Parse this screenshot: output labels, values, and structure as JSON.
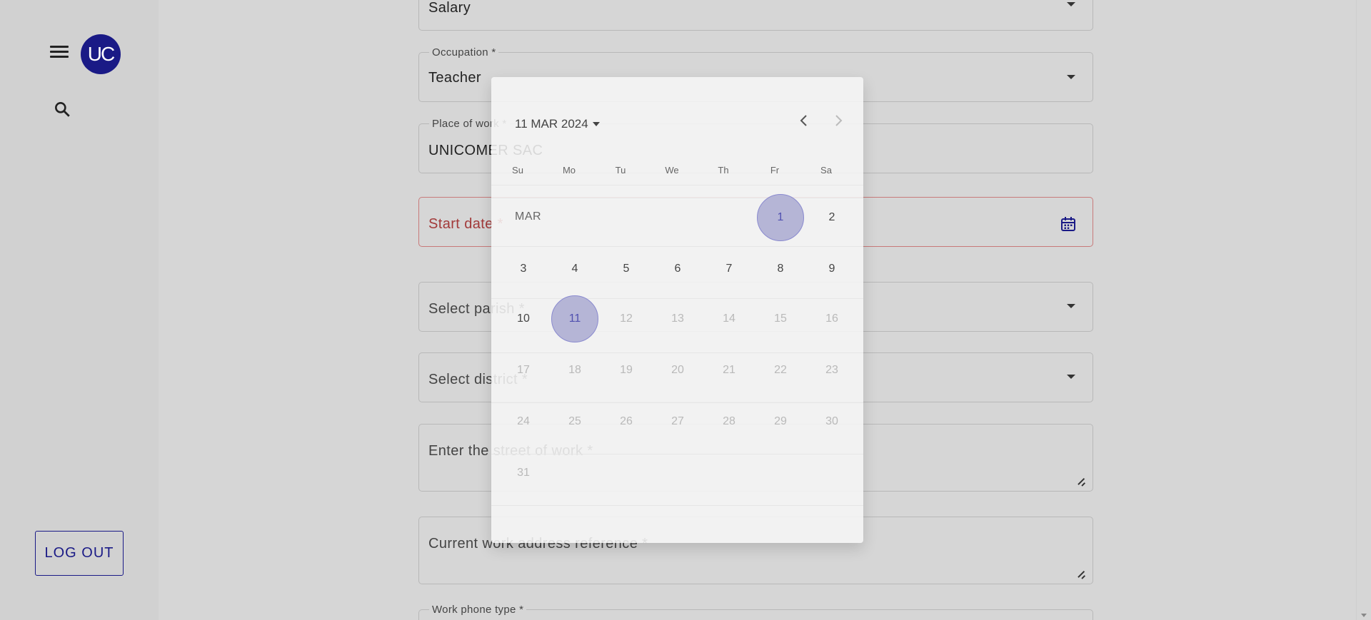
{
  "sidebar": {
    "avatar_text": "UC",
    "logout_label": "LOG OUT",
    "icons": [
      "menu-icon",
      "search-icon"
    ]
  },
  "form": {
    "income_value": "Salary",
    "occupation": {
      "label": "Occupation *",
      "value": "Teacher"
    },
    "place_of_work": {
      "label": "Place of work *",
      "value": "UNICOMER SAC"
    },
    "start_date": {
      "placeholder": "Start date *"
    },
    "parish": {
      "placeholder": "Select parish *"
    },
    "district": {
      "placeholder": "Select district *"
    },
    "street": {
      "placeholder": "Enter the street of work *"
    },
    "reference": {
      "placeholder": "Current work address reference *"
    },
    "phone_type": {
      "label": "Work phone type *"
    }
  },
  "datepicker": {
    "header": "11 MAR 2024",
    "month_label": "MAR",
    "weekdays": [
      "Su",
      "Mo",
      "Tu",
      "We",
      "Th",
      "Fr",
      "Sa"
    ],
    "days": {
      "d1": "1",
      "d2": "2",
      "d3": "3",
      "d4": "4",
      "d5": "5",
      "d6": "6",
      "d7": "7",
      "d8": "8",
      "d9": "9",
      "d10": "10",
      "d11": "11",
      "d12": "12",
      "d13": "13",
      "d14": "14",
      "d15": "15",
      "d16": "16",
      "d17": "17",
      "d18": "18",
      "d19": "19",
      "d20": "20",
      "d21": "21",
      "d22": "22",
      "d23": "23",
      "d24": "24",
      "d25": "25",
      "d26": "26",
      "d27": "27",
      "d28": "28",
      "d29": "29",
      "d30": "30",
      "d31": "31"
    },
    "selected_day": "11",
    "highlighted_day": "1"
  },
  "colors": {
    "brand": "#1a1a86",
    "error": "#a23a3a",
    "selected_day_bg": "#b5b5d6"
  }
}
